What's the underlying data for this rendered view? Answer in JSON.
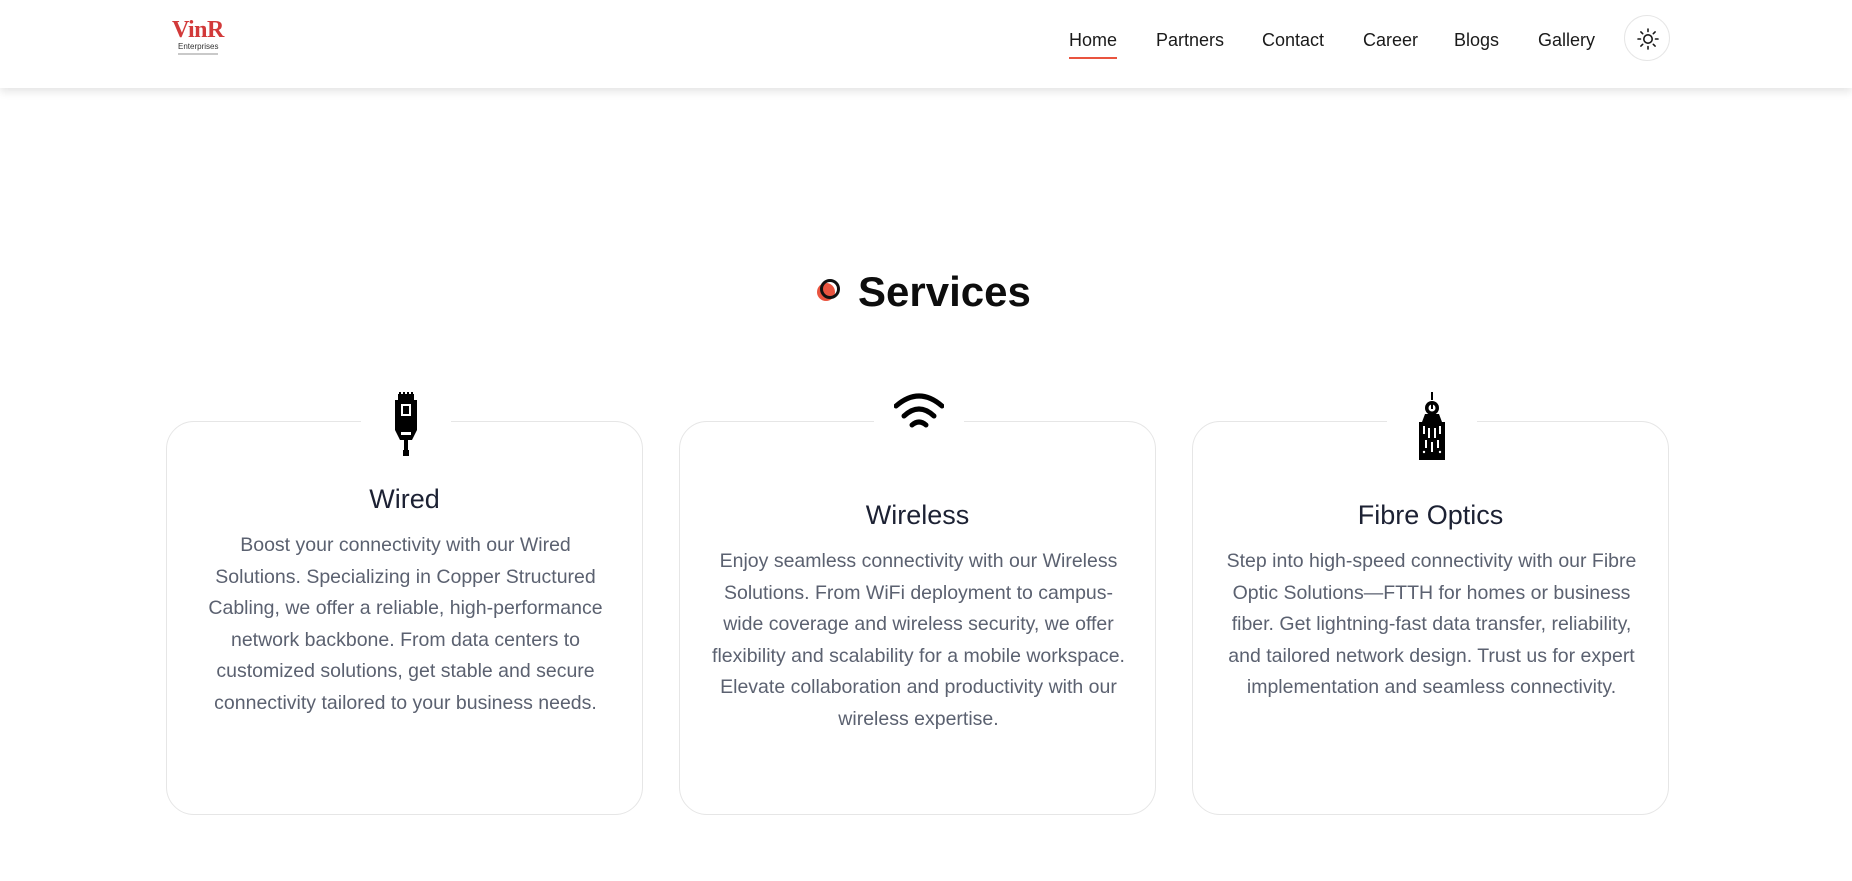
{
  "brand": {
    "logo_main": "VinR",
    "logo_sub": "Enterprises",
    "accent": "#e9543f",
    "logo_color": "#d23a3a"
  },
  "nav": {
    "items": [
      {
        "label": "Home",
        "active": true
      },
      {
        "label": "Partners",
        "active": false
      },
      {
        "label": "Contact",
        "active": false
      },
      {
        "label": "Career",
        "active": false
      },
      {
        "label": "Blogs",
        "active": false
      },
      {
        "label": "Gallery",
        "active": false
      }
    ],
    "theme_toggle_icon": "sun-icon"
  },
  "services": {
    "title": "Services",
    "title_icon": "dot-circle-icon",
    "cards": [
      {
        "icon": "ethernet-cable-icon",
        "title": "Wired",
        "text": "Boost your connectivity with our Wired Solutions. Specializing in Copper Structured Cabling, we offer a reliable, high-performance network backbone. From data centers to customized solutions, get stable and secure connectivity tailored to your business needs."
      },
      {
        "icon": "wifi-icon",
        "title": "Wireless",
        "text": "Enjoy seamless connectivity with our Wireless Solutions. From WiFi deployment to campus-wide coverage and wireless security, we offer flexibility and scalability for a mobile workspace. Elevate collaboration and productivity with our wireless expertise."
      },
      {
        "icon": "fiber-optic-icon",
        "title": "Fibre Optics",
        "text": "Step into high-speed connectivity with our Fibre Optic Solutions—FTTH for homes or business fiber. Get lightning-fast data transfer, reliability, and tailored network design. Trust us for expert implementation and seamless connectivity."
      }
    ]
  }
}
